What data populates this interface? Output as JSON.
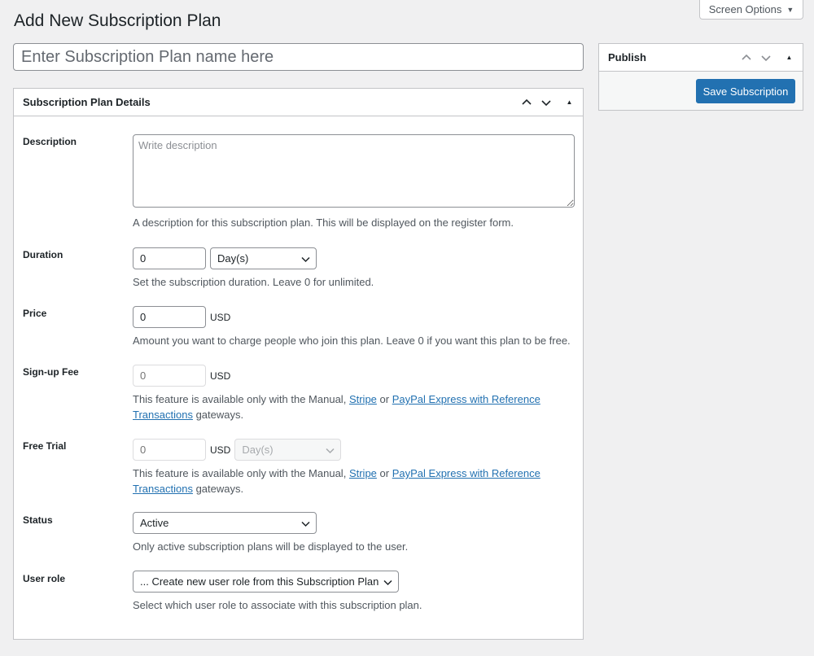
{
  "page": {
    "title": "Add New Subscription Plan",
    "screen_options": "Screen Options",
    "name_placeholder": "Enter Subscription Plan name here"
  },
  "publish": {
    "title": "Publish",
    "save_label": "Save Subscription"
  },
  "details": {
    "title": "Subscription Plan Details",
    "description": {
      "label": "Description",
      "placeholder": "Write description",
      "help": "A description for this subscription plan. This will be displayed on the register form."
    },
    "duration": {
      "label": "Duration",
      "value": "0",
      "unit_selected": "Day(s)",
      "help": "Set the subscription duration. Leave 0 for unlimited."
    },
    "price": {
      "label": "Price",
      "value": "0",
      "currency": "USD",
      "help": "Amount you want to charge people who join this plan. Leave 0 if you want this plan to be free."
    },
    "signup_fee": {
      "label": "Sign-up Fee",
      "placeholder": "0",
      "currency": "USD",
      "help_pre": "This feature is available only with the Manual,",
      "link_stripe": "Stripe",
      "help_or": "or",
      "link_paypal_1": "PayPal Express with Reference",
      "link_paypal_2": "Transactions",
      "help_post": "gateways."
    },
    "free_trial": {
      "label": "Free Trial",
      "placeholder": "0",
      "currency": "USD",
      "unit_selected": "Day(s)",
      "help_pre": "This feature is available only with the Manual,",
      "link_stripe": "Stripe",
      "help_or": "or",
      "link_paypal_1": "PayPal Express with Reference",
      "link_paypal_2": "Transactions",
      "help_post": "gateways."
    },
    "status": {
      "label": "Status",
      "selected": "Active",
      "help": "Only active subscription plans will be displayed to the user."
    },
    "user_role": {
      "label": "User role",
      "selected": "... Create new user role from this Subscription Plan",
      "help": "Select which user role to associate with this subscription plan."
    }
  }
}
